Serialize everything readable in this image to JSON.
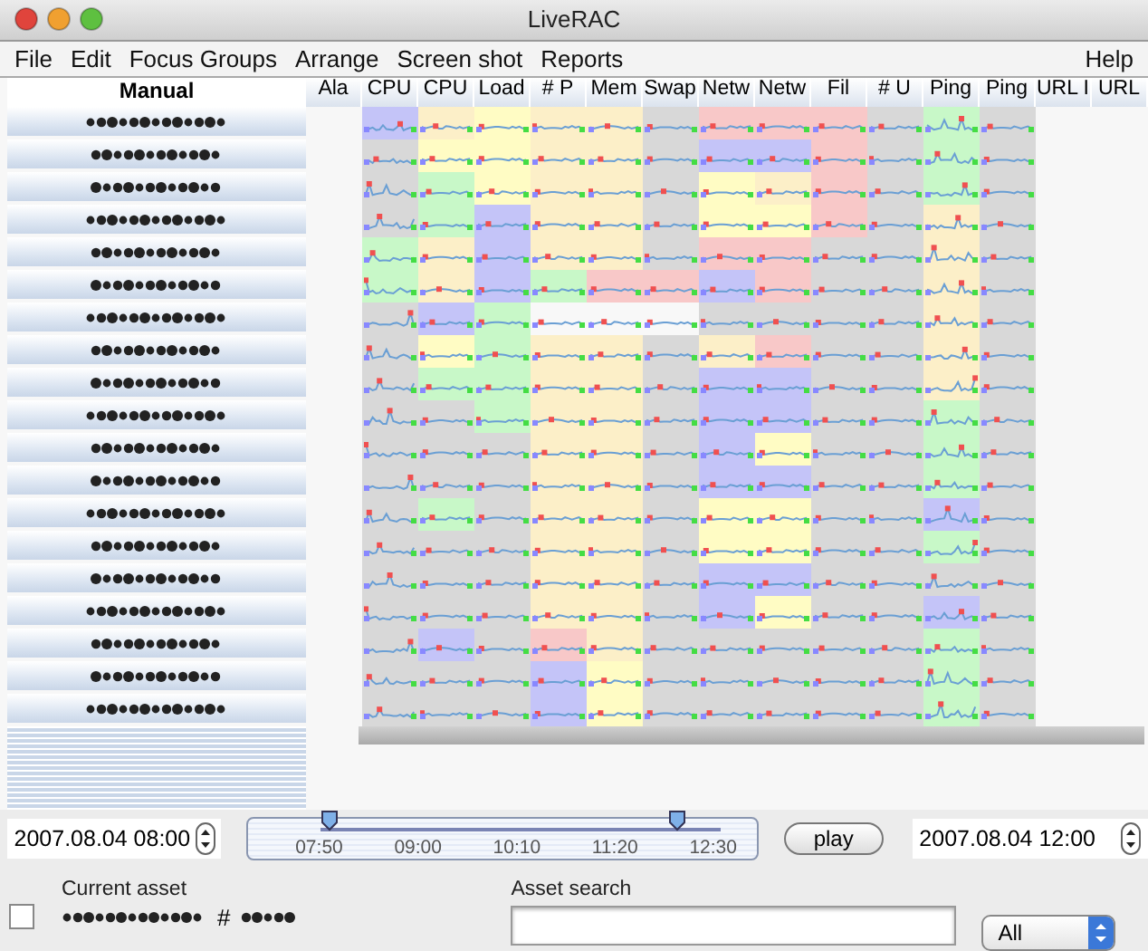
{
  "window": {
    "title": "LiveRAC"
  },
  "menu": [
    {
      "label": "File"
    },
    {
      "label": "Edit"
    },
    {
      "label": "Focus Groups"
    },
    {
      "label": "Arrange"
    },
    {
      "label": "Screen shot"
    },
    {
      "label": "Reports"
    },
    {
      "label": "Help",
      "kind": "right"
    }
  ],
  "label_column": {
    "title": "Manual"
  },
  "columns": [
    {
      "label": "Ala",
      "kind": "empty"
    },
    {
      "label": "CPU",
      "kind": "metric"
    },
    {
      "label": "CPU",
      "kind": "metric"
    },
    {
      "label": "Load",
      "kind": "metric"
    },
    {
      "label": "# P",
      "kind": "metric"
    },
    {
      "label": "Mem",
      "kind": "metric"
    },
    {
      "label": "Swap",
      "kind": "metric"
    },
    {
      "label": "Netw",
      "kind": "metric"
    },
    {
      "label": "Netw",
      "kind": "metric"
    },
    {
      "label": "Fil",
      "kind": "metric"
    },
    {
      "label": "# U",
      "kind": "metric"
    },
    {
      "label": "Ping",
      "kind": "metric"
    },
    {
      "label": "Ping",
      "kind": "metric"
    },
    {
      "label": "URL I",
      "kind": "empty"
    },
    {
      "label": "URL",
      "kind": "empty"
    }
  ],
  "rows": [
    {
      "cells": [
        {
          "color": "#c4c4f8"
        },
        {
          "color": "#fcefc8"
        },
        {
          "color": "#fffcc4"
        },
        {
          "color": "#fcefc8"
        },
        {
          "color": "#fcefc8"
        },
        {
          "color": "#d8d8d8"
        },
        {
          "color": "#f8c8c8"
        },
        {
          "color": "#f8c8c8"
        },
        {
          "color": "#f8c8c8"
        },
        {
          "color": "#d8d8d8"
        },
        {
          "color": "#c8f8c8"
        },
        {
          "color": "#d8d8d8"
        }
      ]
    },
    {
      "cells": [
        {
          "color": "#d8d8d8"
        },
        {
          "color": "#fffcc4"
        },
        {
          "color": "#fffcc4"
        },
        {
          "color": "#fcefc8"
        },
        {
          "color": "#fcefc8"
        },
        {
          "color": "#d8d8d8"
        },
        {
          "color": "#c4c4f8"
        },
        {
          "color": "#c4c4f8"
        },
        {
          "color": "#f8c8c8"
        },
        {
          "color": "#d8d8d8"
        },
        {
          "color": "#c8f8c8"
        },
        {
          "color": "#d8d8d8"
        }
      ]
    },
    {
      "cells": [
        {
          "color": "#d8d8d8"
        },
        {
          "color": "#c8f8c8"
        },
        {
          "color": "#fffcc4"
        },
        {
          "color": "#fcefc8"
        },
        {
          "color": "#fcefc8"
        },
        {
          "color": "#d8d8d8"
        },
        {
          "color": "#fffcc4"
        },
        {
          "color": "#fcefc8"
        },
        {
          "color": "#f8c8c8"
        },
        {
          "color": "#d8d8d8"
        },
        {
          "color": "#c8f8c8"
        },
        {
          "color": "#d8d8d8"
        }
      ]
    },
    {
      "cells": [
        {
          "color": "#d8d8d8"
        },
        {
          "color": "#c8f8c8"
        },
        {
          "color": "#c4c4f8"
        },
        {
          "color": "#fcefc8"
        },
        {
          "color": "#fcefc8"
        },
        {
          "color": "#d8d8d8"
        },
        {
          "color": "#fffcc4"
        },
        {
          "color": "#fffcc4"
        },
        {
          "color": "#f8c8c8"
        },
        {
          "color": "#d8d8d8"
        },
        {
          "color": "#fcefc8"
        },
        {
          "color": "#d8d8d8"
        }
      ]
    },
    {
      "cells": [
        {
          "color": "#c8f8c8"
        },
        {
          "color": "#fcefc8"
        },
        {
          "color": "#c4c4f8"
        },
        {
          "color": "#fcefc8"
        },
        {
          "color": "#fcefc8"
        },
        {
          "color": "#d8d8d8"
        },
        {
          "color": "#f8c8c8"
        },
        {
          "color": "#f8c8c8"
        },
        {
          "color": "#d8d8d8"
        },
        {
          "color": "#d8d8d8"
        },
        {
          "color": "#fcefc8"
        },
        {
          "color": "#d8d8d8"
        }
      ]
    },
    {
      "cells": [
        {
          "color": "#c8f8c8"
        },
        {
          "color": "#fcefc8"
        },
        {
          "color": "#c4c4f8"
        },
        {
          "color": "#c8f8c8"
        },
        {
          "color": "#f8c8c8"
        },
        {
          "color": "#f8c8c8"
        },
        {
          "color": "#c4c4f8"
        },
        {
          "color": "#f8c8c8"
        },
        {
          "color": "#d8d8d8"
        },
        {
          "color": "#d8d8d8"
        },
        {
          "color": "#fcefc8"
        },
        {
          "color": "#d8d8d8"
        }
      ]
    },
    {
      "cells": [
        {
          "color": "#d8d8d8"
        },
        {
          "color": "#c4c4f8"
        },
        {
          "color": "#c8f8c8"
        },
        {
          "color": "#f8f8f8"
        },
        {
          "color": "#f8f8f8"
        },
        {
          "color": "#f8f8f8"
        },
        {
          "color": "#d8d8d8"
        },
        {
          "color": "#d8d8d8"
        },
        {
          "color": "#d8d8d8"
        },
        {
          "color": "#d8d8d8"
        },
        {
          "color": "#fcefc8"
        },
        {
          "color": "#d8d8d8"
        }
      ]
    },
    {
      "cells": [
        {
          "color": "#d8d8d8"
        },
        {
          "color": "#fffcc4"
        },
        {
          "color": "#c8f8c8"
        },
        {
          "color": "#fcefc8"
        },
        {
          "color": "#fcefc8"
        },
        {
          "color": "#d8d8d8"
        },
        {
          "color": "#fcefc8"
        },
        {
          "color": "#f8c8c8"
        },
        {
          "color": "#d8d8d8"
        },
        {
          "color": "#d8d8d8"
        },
        {
          "color": "#fcefc8"
        },
        {
          "color": "#d8d8d8"
        }
      ]
    },
    {
      "cells": [
        {
          "color": "#d8d8d8"
        },
        {
          "color": "#c8f8c8"
        },
        {
          "color": "#c8f8c8"
        },
        {
          "color": "#fcefc8"
        },
        {
          "color": "#fcefc8"
        },
        {
          "color": "#d8d8d8"
        },
        {
          "color": "#c4c4f8"
        },
        {
          "color": "#c4c4f8"
        },
        {
          "color": "#d8d8d8"
        },
        {
          "color": "#d8d8d8"
        },
        {
          "color": "#fcefc8"
        },
        {
          "color": "#d8d8d8"
        }
      ]
    },
    {
      "cells": [
        {
          "color": "#d8d8d8"
        },
        {
          "color": "#d8d8d8"
        },
        {
          "color": "#c8f8c8"
        },
        {
          "color": "#fcefc8"
        },
        {
          "color": "#fcefc8"
        },
        {
          "color": "#d8d8d8"
        },
        {
          "color": "#c4c4f8"
        },
        {
          "color": "#c4c4f8"
        },
        {
          "color": "#d8d8d8"
        },
        {
          "color": "#d8d8d8"
        },
        {
          "color": "#c8f8c8"
        },
        {
          "color": "#d8d8d8"
        }
      ]
    },
    {
      "cells": [
        {
          "color": "#d8d8d8"
        },
        {
          "color": "#d8d8d8"
        },
        {
          "color": "#d8d8d8"
        },
        {
          "color": "#fcefc8"
        },
        {
          "color": "#fcefc8"
        },
        {
          "color": "#d8d8d8"
        },
        {
          "color": "#c4c4f8"
        },
        {
          "color": "#fffcc4"
        },
        {
          "color": "#d8d8d8"
        },
        {
          "color": "#d8d8d8"
        },
        {
          "color": "#c8f8c8"
        },
        {
          "color": "#d8d8d8"
        }
      ]
    },
    {
      "cells": [
        {
          "color": "#d8d8d8"
        },
        {
          "color": "#d8d8d8"
        },
        {
          "color": "#d8d8d8"
        },
        {
          "color": "#fcefc8"
        },
        {
          "color": "#fcefc8"
        },
        {
          "color": "#d8d8d8"
        },
        {
          "color": "#c4c4f8"
        },
        {
          "color": "#c4c4f8"
        },
        {
          "color": "#d8d8d8"
        },
        {
          "color": "#d8d8d8"
        },
        {
          "color": "#c8f8c8"
        },
        {
          "color": "#d8d8d8"
        }
      ]
    },
    {
      "cells": [
        {
          "color": "#d8d8d8"
        },
        {
          "color": "#c8f8c8"
        },
        {
          "color": "#d8d8d8"
        },
        {
          "color": "#fcefc8"
        },
        {
          "color": "#fcefc8"
        },
        {
          "color": "#d8d8d8"
        },
        {
          "color": "#fffcc4"
        },
        {
          "color": "#fffcc4"
        },
        {
          "color": "#d8d8d8"
        },
        {
          "color": "#d8d8d8"
        },
        {
          "color": "#c4c4f8"
        },
        {
          "color": "#d8d8d8"
        }
      ]
    },
    {
      "cells": [
        {
          "color": "#d8d8d8"
        },
        {
          "color": "#d8d8d8"
        },
        {
          "color": "#d8d8d8"
        },
        {
          "color": "#fcefc8"
        },
        {
          "color": "#fcefc8"
        },
        {
          "color": "#d8d8d8"
        },
        {
          "color": "#fffcc4"
        },
        {
          "color": "#fffcc4"
        },
        {
          "color": "#d8d8d8"
        },
        {
          "color": "#d8d8d8"
        },
        {
          "color": "#c8f8c8"
        },
        {
          "color": "#d8d8d8"
        }
      ]
    },
    {
      "cells": [
        {
          "color": "#d8d8d8"
        },
        {
          "color": "#d8d8d8"
        },
        {
          "color": "#d8d8d8"
        },
        {
          "color": "#fcefc8"
        },
        {
          "color": "#fcefc8"
        },
        {
          "color": "#d8d8d8"
        },
        {
          "color": "#c4c4f8"
        },
        {
          "color": "#c4c4f8"
        },
        {
          "color": "#d8d8d8"
        },
        {
          "color": "#d8d8d8"
        },
        {
          "color": "#d8d8d8"
        },
        {
          "color": "#d8d8d8"
        }
      ]
    },
    {
      "cells": [
        {
          "color": "#d8d8d8"
        },
        {
          "color": "#d8d8d8"
        },
        {
          "color": "#d8d8d8"
        },
        {
          "color": "#fcefc8"
        },
        {
          "color": "#fcefc8"
        },
        {
          "color": "#d8d8d8"
        },
        {
          "color": "#c4c4f8"
        },
        {
          "color": "#fffcc4"
        },
        {
          "color": "#d8d8d8"
        },
        {
          "color": "#d8d8d8"
        },
        {
          "color": "#c4c4f8"
        },
        {
          "color": "#d8d8d8"
        }
      ]
    },
    {
      "cells": [
        {
          "color": "#d8d8d8"
        },
        {
          "color": "#c4c4f8"
        },
        {
          "color": "#d8d8d8"
        },
        {
          "color": "#f8c8c8"
        },
        {
          "color": "#fcefc8"
        },
        {
          "color": "#d8d8d8"
        },
        {
          "color": "#d8d8d8"
        },
        {
          "color": "#d8d8d8"
        },
        {
          "color": "#d8d8d8"
        },
        {
          "color": "#d8d8d8"
        },
        {
          "color": "#c8f8c8"
        },
        {
          "color": "#d8d8d8"
        }
      ]
    },
    {
      "cells": [
        {
          "color": "#d8d8d8"
        },
        {
          "color": "#d8d8d8"
        },
        {
          "color": "#d8d8d8"
        },
        {
          "color": "#c4c4f8"
        },
        {
          "color": "#fffcc4"
        },
        {
          "color": "#d8d8d8"
        },
        {
          "color": "#d8d8d8"
        },
        {
          "color": "#d8d8d8"
        },
        {
          "color": "#d8d8d8"
        },
        {
          "color": "#d8d8d8"
        },
        {
          "color": "#c8f8c8"
        },
        {
          "color": "#d8d8d8"
        }
      ]
    },
    {
      "cells": [
        {
          "color": "#d8d8d8"
        },
        {
          "color": "#d8d8d8"
        },
        {
          "color": "#d8d8d8"
        },
        {
          "color": "#c4c4f8"
        },
        {
          "color": "#fffcc4"
        },
        {
          "color": "#d8d8d8"
        },
        {
          "color": "#d8d8d8"
        },
        {
          "color": "#d8d8d8"
        },
        {
          "color": "#d8d8d8"
        },
        {
          "color": "#d8d8d8"
        },
        {
          "color": "#c8f8c8"
        },
        {
          "color": "#d8d8d8"
        }
      ]
    }
  ],
  "time_range": {
    "start": "2007.08.04 08:00",
    "end": "2007.08.04 12:00",
    "ticks": [
      "07:50",
      "09:00",
      "10:10",
      "11:20",
      "12:30"
    ],
    "thumbs": [
      {
        "level": 0.02
      },
      {
        "level": 0.89
      }
    ],
    "play": "play"
  },
  "current_asset": {
    "label": "Current asset",
    "checked": false,
    "hash": "#"
  },
  "asset_search": {
    "label": "Asset search",
    "filter": "All"
  }
}
